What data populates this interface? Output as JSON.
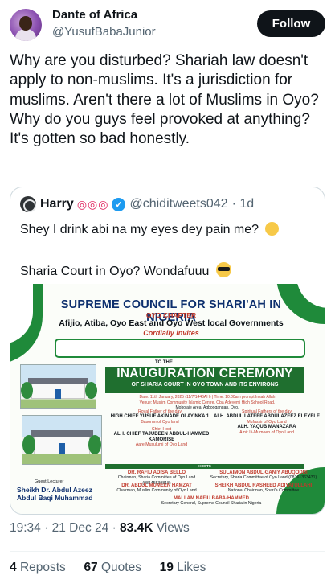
{
  "author": {
    "name": "Dante of Africa",
    "handle": "@YusufBabaJunior",
    "follow_label": "Follow"
  },
  "tweet": {
    "text": "Why are you disturbed? Shariah law doesn't apply to non-muslims. It's a jurisdiction for muslims. Aren't there a lot of Muslims in Oyo? Why do you guys feel provoked at anything? It's gotten so bad honestly."
  },
  "quote": {
    "name": "Harry",
    "name_emojis": "◎◎◎",
    "handle": "@chiditweets042",
    "time": "· 1d",
    "text1": "Shey I drink abi na my eyes dey pain me?",
    "text2": "Sharia Court in Oyo? Wondafuuu",
    "flyer": {
      "title": "SUPREME COUNCIL FOR SHARI'AH IN NIGERIA",
      "chapter": "OYO CHAPTER",
      "governments": "Afijio, Atiba, Oyo East and Oyo West local Governments",
      "invites": "Cordially Invites",
      "to_the": "TO THE",
      "event": "INAUGURATION CEREMONY",
      "event_sub": "OF SHARIA COURT IN OYO TOWN AND ITS ENVIRONS",
      "date_line": "Date: 11th January, 2025 (11/7/1446AH) | Time: 10:00am prompt Insah Allah",
      "venue_line": "Venue: Muslim Community Islamic Centre, Oba Adeyemi High School Road,",
      "venue_line2": "Mobolaje Area, Agboogangan, Oyo.",
      "royal_label": "Royal Father of the day",
      "royal_name": "HIGH CHIEF YUSUF AKINADE OLAYINKA 1",
      "royal_title": "Basorun of Oyo land",
      "spiritual_label": "Spiritual Fathers of the day",
      "spiritual_name1": "ALH. ABDUL LATEEF ABDULAZEEZ ELEYELE",
      "spiritual_title1": "Mufassir of Oyo Land",
      "spiritual_name2": "ALH. YAQUB MANAZARA",
      "spiritual_title2": "Amir Li-Mumeen of Oyo Land",
      "chief_host_label": "Chief Host",
      "chief_host_name": "ALH. CHIEF TAJUDEEN ABDUL-HAMMED KAMORISE",
      "chief_host_title": "Aare Musulumi of Oyo Land",
      "hosts_label": "HOSTS",
      "host1_name": "DR. RAFIU ADISA BELLO",
      "host1_title": "Chairman, Sharia Committee of Oyo Land (08145539818)",
      "host2_name": "SULAIMON ABDUL-GANIY ABUQODDI",
      "host2_title": "Secretary, Sharia Committee of Oyo Land (08161363431)",
      "host3_name": "DR. ABDUL MUMEEN HAMZAT",
      "host3_title": "Chairman, Muslim Community of Oyo Land",
      "host4_name": "SHEIKH ABDUL RASHEED ADIYATULLAHI",
      "host4_title": "National Chairman, Shari'a Committee",
      "host5_name": "MALLAM NAFIU BABA-HAMMED",
      "host5_title": "Secretary General, Supreme Council Sharia in Nigeria",
      "lecturer_label": "Guest Lecturer",
      "lecturer_name1": "Sheikh Dr. Abdul Azeez",
      "lecturer_name2": "Abdul Baqi Muhammad"
    }
  },
  "meta": {
    "time": "19:34",
    "date": "21 Dec 24",
    "views_count": "83.4K",
    "views_label": "Views"
  },
  "stats": {
    "reposts_count": "4",
    "reposts_label": "Reposts",
    "quotes_count": "67",
    "quotes_label": "Quotes",
    "likes_count": "19",
    "likes_label": "Likes"
  },
  "colors": {
    "brand_green": "#1f8a3a",
    "navy": "#0d2f6e",
    "verified_blue": "#1d9bf0"
  }
}
